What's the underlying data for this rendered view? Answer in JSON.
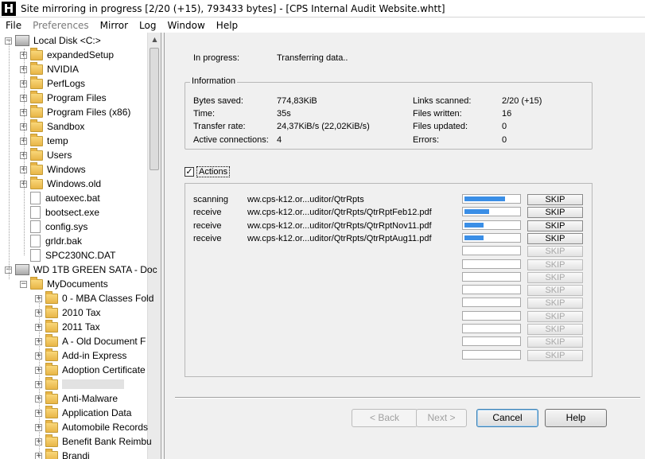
{
  "window": {
    "title": "Site mirroring in progress [2/20 (+15), 793433 bytes] - [CPS Internal Audit Website.whtt]",
    "logo_letter": "H"
  },
  "menu": [
    "File",
    "Preferences",
    "Mirror",
    "Log",
    "Window",
    "Help"
  ],
  "tree": [
    {
      "label": "Local Disk <C:>",
      "kind": "drive-c",
      "depth": 0,
      "expander": "−"
    },
    {
      "label": "expandedSetup",
      "kind": "folder",
      "depth": 1,
      "expander": "+"
    },
    {
      "label": "NVIDIA",
      "kind": "folder",
      "depth": 1,
      "expander": "+"
    },
    {
      "label": "PerfLogs",
      "kind": "folder",
      "depth": 1,
      "expander": "+"
    },
    {
      "label": "Program Files",
      "kind": "folder",
      "depth": 1,
      "expander": "+"
    },
    {
      "label": "Program Files (x86)",
      "kind": "folder",
      "depth": 1,
      "expander": "+"
    },
    {
      "label": "Sandbox",
      "kind": "folder",
      "depth": 1,
      "expander": "+"
    },
    {
      "label": "temp",
      "kind": "folder",
      "depth": 1,
      "expander": "+"
    },
    {
      "label": "Users",
      "kind": "folder",
      "depth": 1,
      "expander": "+"
    },
    {
      "label": "Windows",
      "kind": "folder",
      "depth": 1,
      "expander": "+"
    },
    {
      "label": "Windows.old",
      "kind": "folder",
      "depth": 1,
      "expander": "+"
    },
    {
      "label": "autoexec.bat",
      "kind": "file",
      "depth": 1,
      "expander": ""
    },
    {
      "label": "bootsect.exe",
      "kind": "file",
      "depth": 1,
      "expander": ""
    },
    {
      "label": "config.sys",
      "kind": "file",
      "depth": 1,
      "expander": ""
    },
    {
      "label": "grldr.bak",
      "kind": "file",
      "depth": 1,
      "expander": ""
    },
    {
      "label": "SPC230NC.DAT",
      "kind": "file",
      "depth": 1,
      "expander": ""
    },
    {
      "label": "WD 1TB GREEN SATA - Doc",
      "kind": "drive",
      "depth": 0,
      "expander": "−"
    },
    {
      "label": "MyDocuments",
      "kind": "folder",
      "depth": 1,
      "expander": "−"
    },
    {
      "label": "0 - MBA Classes Fold",
      "kind": "folder",
      "depth": 2,
      "expander": "+"
    },
    {
      "label": "2010 Tax",
      "kind": "folder",
      "depth": 2,
      "expander": "+"
    },
    {
      "label": "2011 Tax",
      "kind": "folder",
      "depth": 2,
      "expander": "+"
    },
    {
      "label": "A - Old Document F",
      "kind": "folder",
      "depth": 2,
      "expander": "+"
    },
    {
      "label": "Add-in Express",
      "kind": "folder",
      "depth": 2,
      "expander": "+"
    },
    {
      "label": "Adoption Certificate",
      "kind": "folder",
      "depth": 2,
      "expander": "+"
    },
    {
      "label": "",
      "kind": "folder-blurred",
      "depth": 2,
      "expander": "+"
    },
    {
      "label": "Anti-Malware",
      "kind": "folder",
      "depth": 2,
      "expander": "+"
    },
    {
      "label": "Application Data",
      "kind": "folder",
      "depth": 2,
      "expander": "+"
    },
    {
      "label": "Automobile Records",
      "kind": "folder",
      "depth": 2,
      "expander": "+"
    },
    {
      "label": "Benefit Bank Reimbu",
      "kind": "folder",
      "depth": 2,
      "expander": "+"
    },
    {
      "label": "Brandi",
      "kind": "folder",
      "depth": 2,
      "expander": "+"
    }
  ],
  "status": {
    "in_progress_label": "In progress:",
    "in_progress_value": "Transferring data.."
  },
  "information": {
    "title": "Information",
    "left": [
      {
        "label": "Bytes saved:",
        "value": "774,83KiB"
      },
      {
        "label": "Time:",
        "value": "35s"
      },
      {
        "label": "Transfer rate:",
        "value": "24,37KiB/s (22,02KiB/s)"
      },
      {
        "label": "Active connections:",
        "value": "4"
      }
    ],
    "right": [
      {
        "label": "Links scanned:",
        "value": "2/20 (+15)"
      },
      {
        "label": "Files written:",
        "value": "16"
      },
      {
        "label": "Files updated:",
        "value": "0"
      },
      {
        "label": "Errors:",
        "value": "0"
      }
    ]
  },
  "actions": {
    "checkbox_label": "Actions",
    "checked": true,
    "skip_label": "SKIP",
    "rows": [
      {
        "type": "scanning",
        "path": "ww.cps-k12.or...uditor/QtrRpts",
        "progress": 0.75
      },
      {
        "type": "receive",
        "path": "ww.cps-k12.or...uditor/QtrRpts/QtrRptFeb12.pdf",
        "progress": 0.45
      },
      {
        "type": "receive",
        "path": "ww.cps-k12.or...uditor/QtrRpts/QtrRptNov11.pdf",
        "progress": 0.35
      },
      {
        "type": "receive",
        "path": "ww.cps-k12.or...uditor/QtrRpts/QtrRptAug11.pdf",
        "progress": 0.35
      },
      {
        "type": "",
        "path": "",
        "progress": null
      },
      {
        "type": "",
        "path": "",
        "progress": null
      },
      {
        "type": "",
        "path": "",
        "progress": null
      },
      {
        "type": "",
        "path": "",
        "progress": null
      },
      {
        "type": "",
        "path": "",
        "progress": null
      },
      {
        "type": "",
        "path": "",
        "progress": null
      },
      {
        "type": "",
        "path": "",
        "progress": null
      },
      {
        "type": "",
        "path": "",
        "progress": null
      },
      {
        "type": "",
        "path": "",
        "progress": null
      }
    ]
  },
  "buttons": {
    "back": "< Back",
    "next": "Next >",
    "cancel": "Cancel",
    "help": "Help"
  },
  "colors": {
    "progress_fill": "#3a8ee6",
    "default_button_border": "#3c7fb1"
  }
}
